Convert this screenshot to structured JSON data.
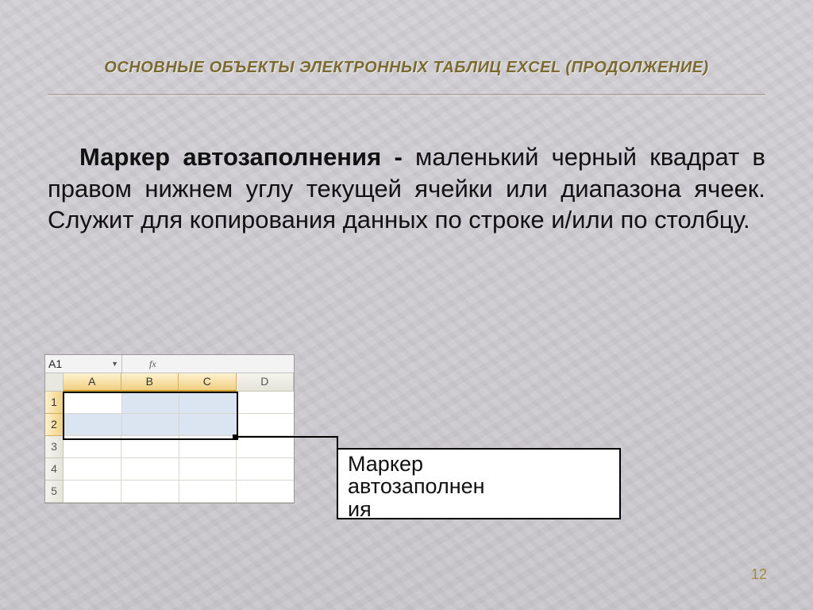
{
  "title": "ОСНОВНЫЕ ОБЪЕКТЫ ЭЛЕКТРОННЫХ ТАБЛИЦ EXCEL (ПРОДОЛЖЕНИЕ)",
  "body": {
    "term": "Маркер автозаполнения - ",
    "definition": "маленький черный квадрат в правом нижнем углу текущей ячейки или диапазона ячеек. Служит для копирования данных по строке и/или по столбцу."
  },
  "excel": {
    "namebox": "A1",
    "fx_glyph": "fx",
    "columns": [
      "A",
      "B",
      "C",
      "D"
    ],
    "rows": [
      "1",
      "2",
      "3",
      "4",
      "5"
    ]
  },
  "callout": {
    "line1": "Маркер",
    "line2": "автозаполнен",
    "line3": "ия"
  },
  "page_number": "12"
}
